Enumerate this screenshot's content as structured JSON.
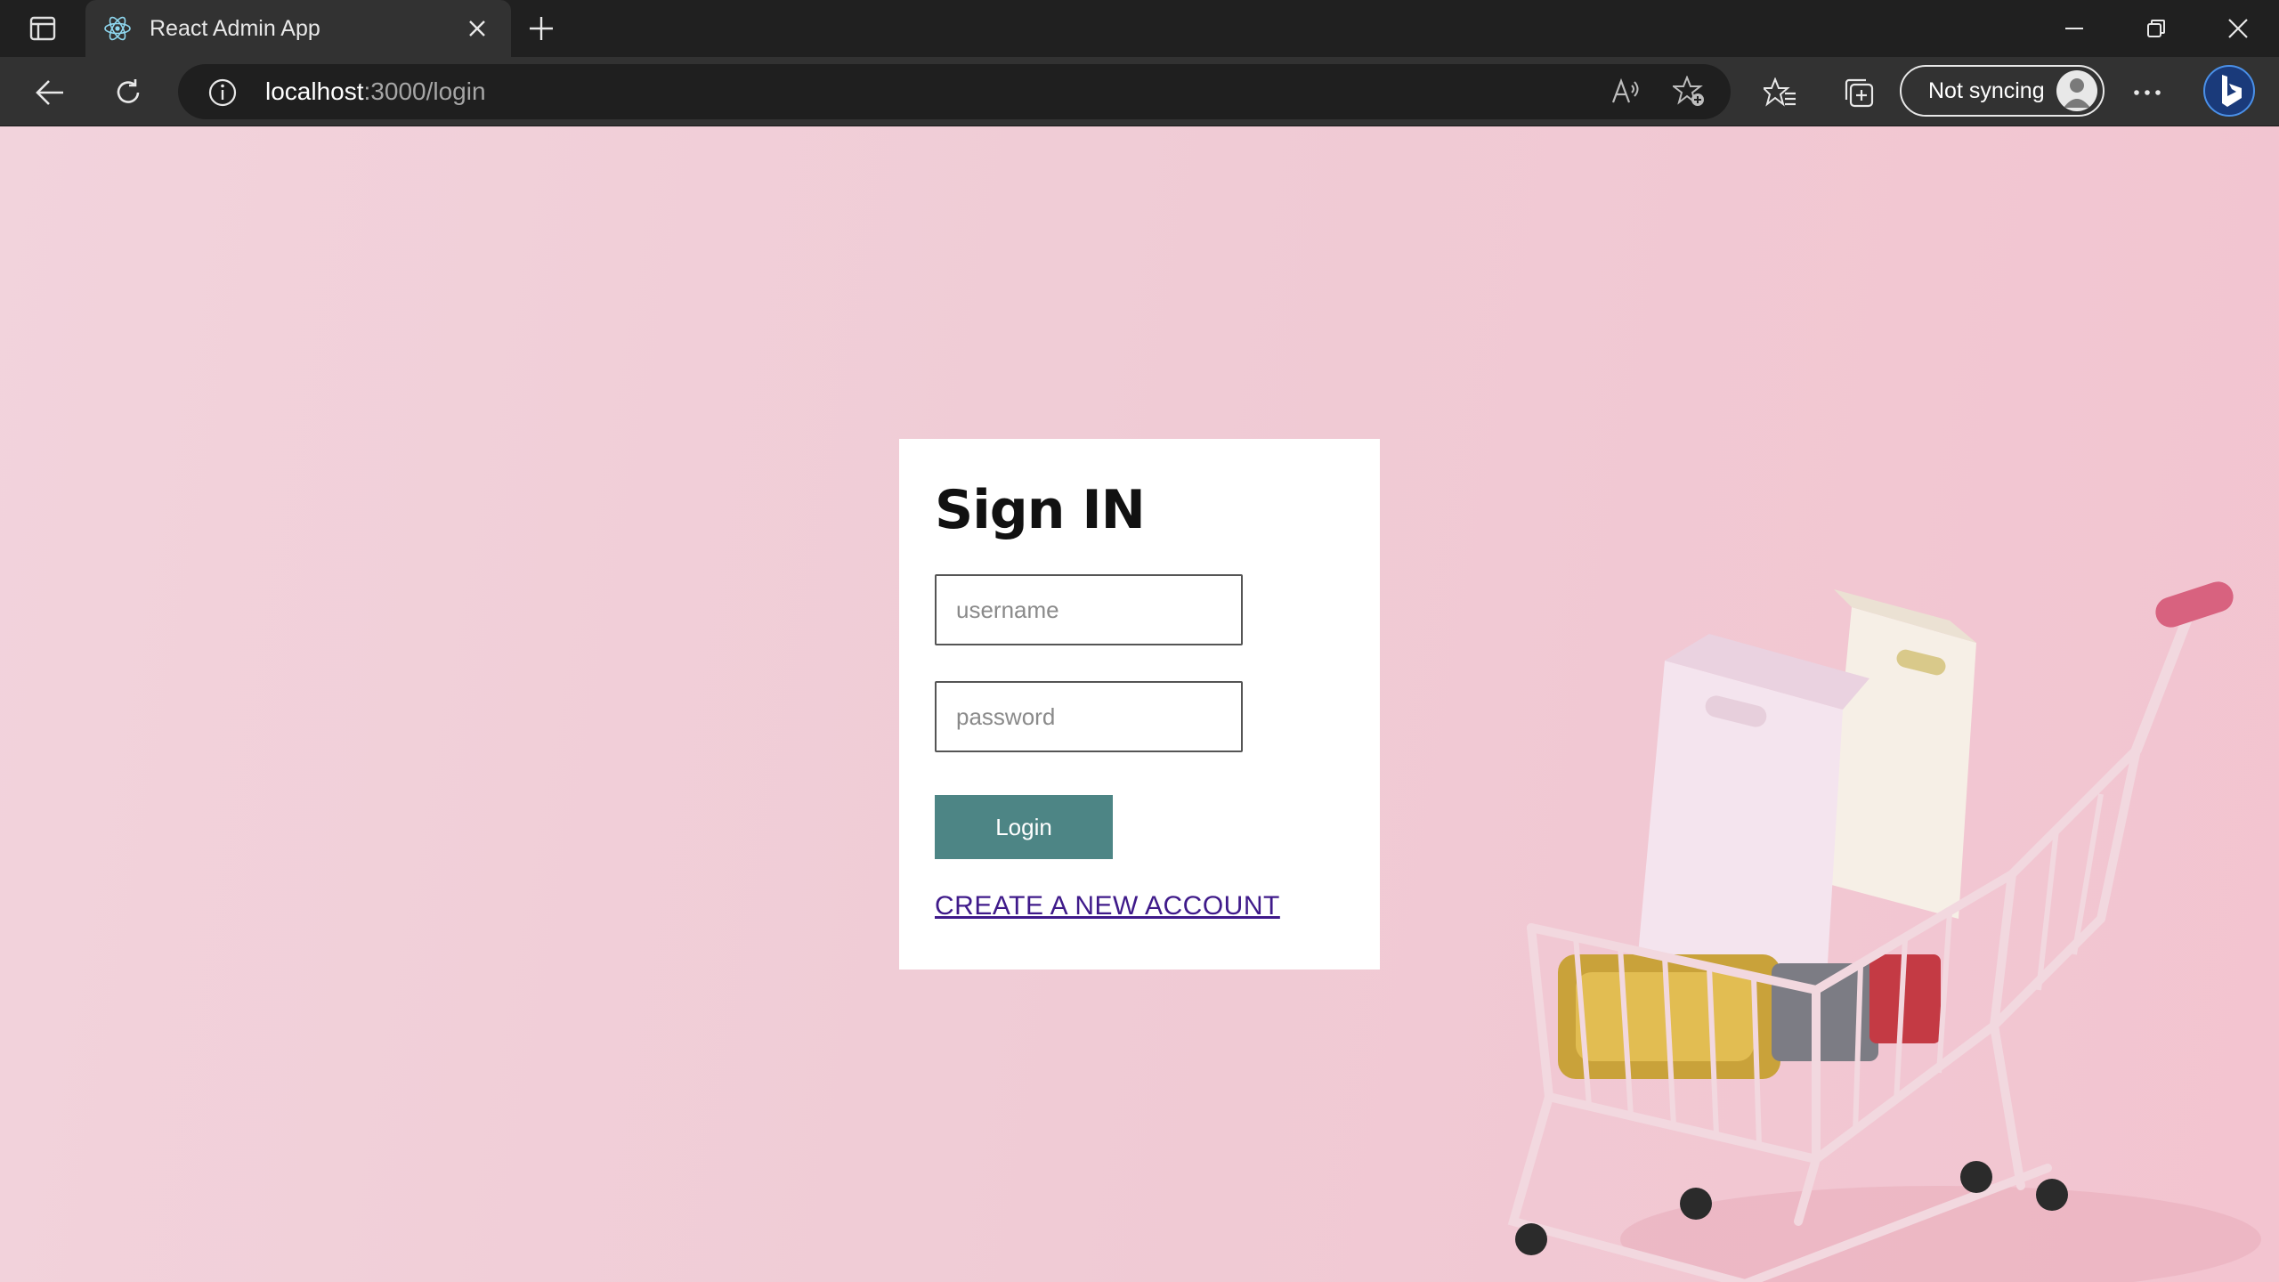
{
  "browser": {
    "tab": {
      "title": "React Admin App",
      "favicon": "react-logo-icon"
    },
    "address_bar": {
      "host": "localhost",
      "path": ":3000/login"
    },
    "profile": {
      "status_label": "Not syncing"
    },
    "icons": {
      "tab_actions": "tab-actions-icon",
      "close_tab": "close-icon",
      "new_tab": "plus-icon",
      "minimize": "minimize-icon",
      "restore": "restore-icon",
      "close_window": "close-icon",
      "back": "back-arrow-icon",
      "refresh": "refresh-icon",
      "site_info": "info-icon",
      "read_aloud": "read-aloud-icon",
      "add_favorite": "add-favorite-icon",
      "favorites": "favorites-icon",
      "collections": "collections-icon",
      "more": "more-icon",
      "copilot": "bing-icon"
    }
  },
  "login": {
    "title": "Sign IN",
    "username_placeholder": "username",
    "password_placeholder": "password",
    "submit_label": "Login",
    "create_account_label": "CREATE A NEW ACCOUNT"
  },
  "colors": {
    "page_background": "#f0cfd8",
    "button": "#4d8585",
    "link": "#3f1a8a",
    "browser_chrome": "#202020"
  }
}
